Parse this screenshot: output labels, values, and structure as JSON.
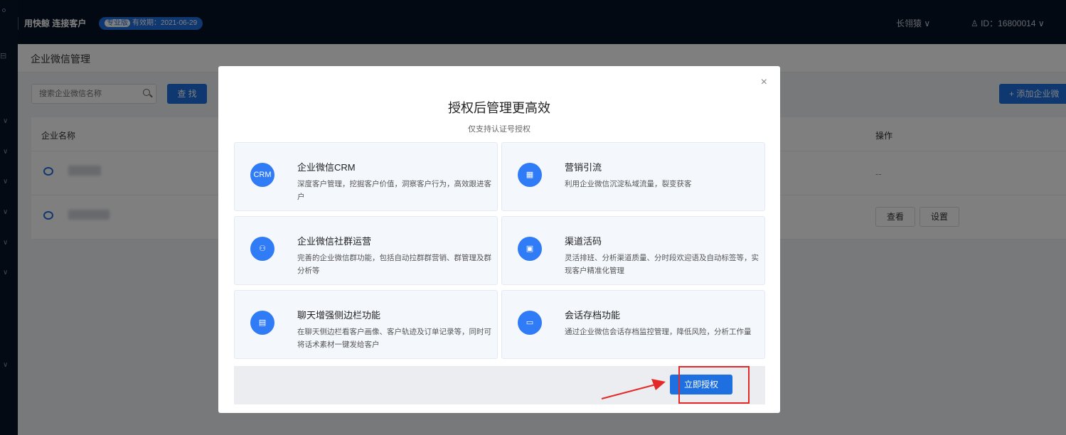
{
  "topbar": {
    "brand": "用快鲸 连接客户",
    "edition": "专业版",
    "valid": "有效期：2021-06-29",
    "user_menu": "长翎猿 ∨",
    "account": "ID：16800014 ∨"
  },
  "page": {
    "breadcrumb": "企业微信管理",
    "search_placeholder": "搜索企业微信名称",
    "find_button": "查 找",
    "add_button": "+ 添加企业微",
    "columns": [
      "企业名称",
      "操作"
    ],
    "row1_op": "--",
    "view_button": "查看",
    "settings_button": "设置"
  },
  "modal": {
    "close": "×",
    "title": "授权后管理更高效",
    "subtitle": "仅支持认证号授权",
    "features": [
      {
        "icon": "crm-icon",
        "icon_text": "CRM",
        "title": "企业微信CRM",
        "desc": "深度客户管理，挖掘客户价值，洞察客户行为，高效跟进客户"
      },
      {
        "icon": "chart-icon",
        "icon_text": "",
        "title": "营销引流",
        "desc": "利用企业微信沉淀私域流量，裂变获客"
      },
      {
        "icon": "community-icon",
        "icon_text": "",
        "title": "企业微信社群运营",
        "desc": "完善的企业微信群功能，包括自动拉群群营销、群管理及群分析等"
      },
      {
        "icon": "qrcode-icon",
        "icon_text": "",
        "title": "渠道活码",
        "desc": "灵活排班、分析渠道质量、分时段欢迎语及自动标签等，实现客户精准化管理"
      },
      {
        "icon": "sidebar-icon",
        "icon_text": "",
        "title": "聊天增强侧边栏功能",
        "desc": "在聊天侧边栏看客户画像、客户轨迹及订单记录等，同时可将话术素材一键发给客户"
      },
      {
        "icon": "chat-archive-icon",
        "icon_text": "",
        "title": "会话存档功能",
        "desc": "通过企业微信会话存档监控管理，降低风险，分析工作量"
      }
    ],
    "authorize_button": "立即授权"
  }
}
